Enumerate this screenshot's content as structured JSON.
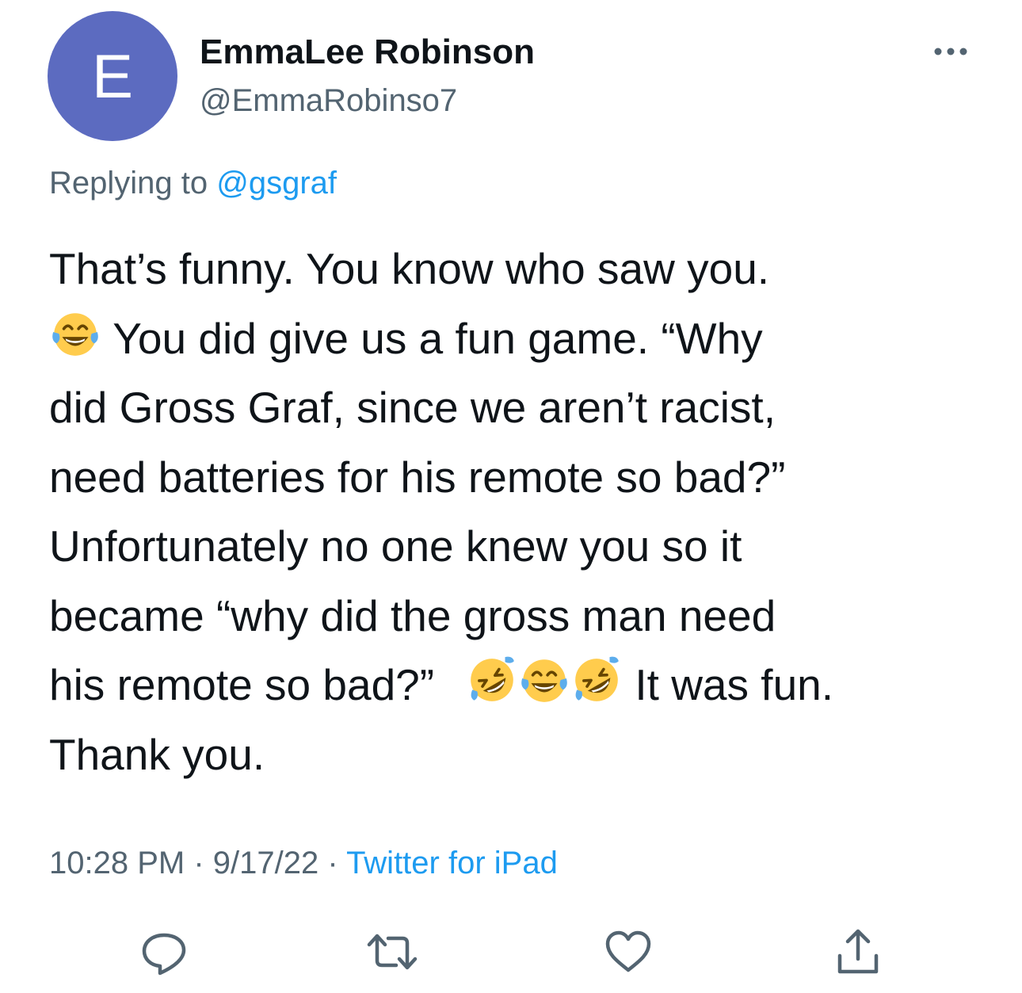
{
  "tweet": {
    "avatar_letter": "E",
    "avatar_color": "#5c6bc0",
    "display_name": "EmmaLee Robinson",
    "handle": "@EmmaRobinso7",
    "more_icon": "more-horizontal-icon",
    "replying_prefix": "Replying to ",
    "replying_to": "@gsgraf",
    "text_lines": [
      {
        "text": "That’s funny. You know who saw you."
      },
      {
        "emoji_lead": "face-with-tears-of-joy",
        "text": " You did give us a fun game. “Why"
      },
      {
        "text": "did Gross Graf, since we aren’t racist,"
      },
      {
        "text": "need batteries for his remote so bad?”"
      },
      {
        "text": "Unfortunately no one knew you so it"
      },
      {
        "text": "became “why did the gross man need"
      },
      {
        "text": "his remote so bad?”",
        "emojis": [
          "rolling-on-the-floor-laughing",
          "face-with-tears-of-joy",
          "rolling-on-the-floor-laughing"
        ],
        "text_after": " It was fun."
      },
      {
        "text": "Thank you."
      }
    ],
    "time": "10:28 PM",
    "separator": " · ",
    "date": "9/17/22",
    "source": "Twitter for iPad"
  },
  "actions": [
    {
      "name": "reply",
      "icon": "reply-icon"
    },
    {
      "name": "retweet",
      "icon": "retweet-icon"
    },
    {
      "name": "like",
      "icon": "heart-icon"
    },
    {
      "name": "share",
      "icon": "share-icon"
    }
  ],
  "colors": {
    "text": "#0f1419",
    "secondary": "#536471",
    "link": "#1d9bf0",
    "emoji_face": "#ffcc4d"
  }
}
